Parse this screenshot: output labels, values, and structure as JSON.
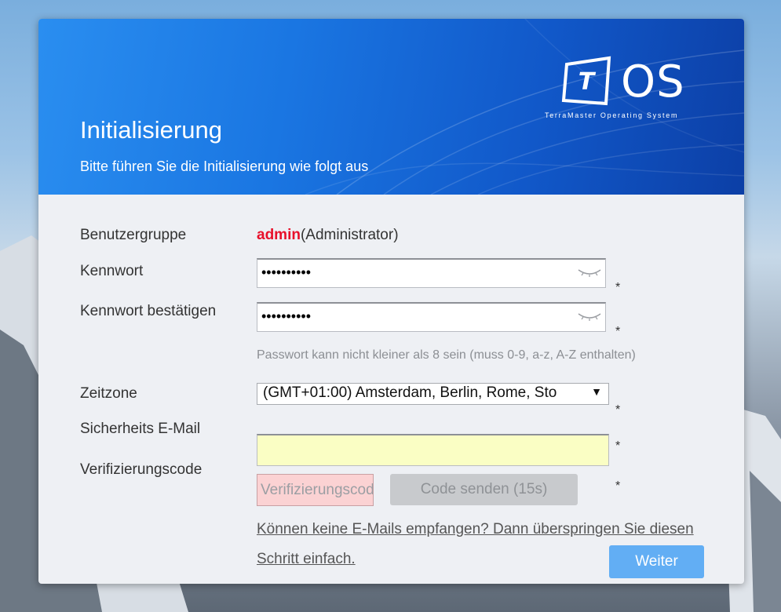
{
  "banner": {
    "title": "Initialisierung",
    "subtitle": "Bitte führen Sie die Initialisierung wie folgt aus",
    "logo_text": "OS",
    "logo_letter": "T",
    "logo_tagline": "TerraMaster Operating System"
  },
  "form": {
    "usergroup_label": "Benutzergruppe",
    "usergroup_value_name": "admin",
    "usergroup_value_role": "(Administrator)",
    "password_label": "Kennwort",
    "password_value": "••••••••••",
    "confirm_label": "Kennwort bestätigen",
    "confirm_value": "••••••••••",
    "required_mark": "*",
    "password_hint": "Passwort kann nicht kleiner als 8 sein (muss 0-9, a-z, A-Z enthalten)",
    "timezone_label": "Zeitzone",
    "timezone_value": "(GMT+01:00) Amsterdam, Berlin, Rome, Sto",
    "email_label": "Sicherheits E-Mail",
    "email_value": "",
    "code_label": "Verifizierungscode",
    "code_placeholder": "Verifizierungscode",
    "send_code_button": "Code senden (15s)",
    "skip_link": "Können keine E-Mails empfangen? Dann überspringen Sie diesen Schritt einfach.",
    "next_button": "Weiter"
  },
  "colors": {
    "banner_blue": "#1a76e2",
    "admin_red": "#e8102a",
    "email_bg": "#fafec4",
    "code_bg": "#fbd2d3",
    "next_button": "#62aef4"
  }
}
